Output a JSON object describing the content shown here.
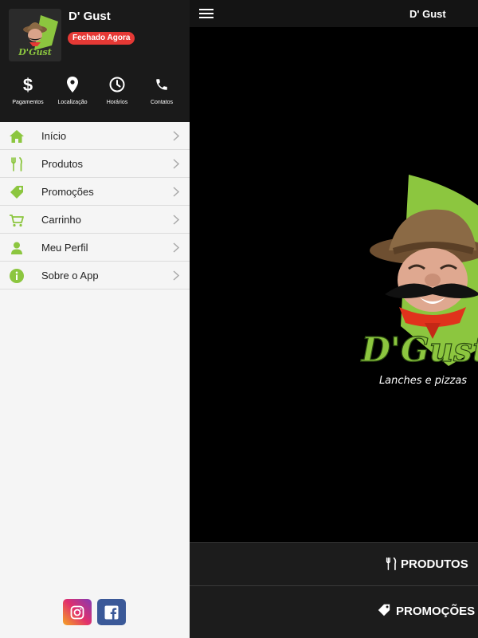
{
  "drawer": {
    "store_name": "D' Gust",
    "status": "Fechado Agora",
    "logo_text": "D'Gust",
    "quick_actions": [
      {
        "label": "Pagamentos",
        "icon": "dollar-icon"
      },
      {
        "label": "Localização",
        "icon": "location-pin-icon"
      },
      {
        "label": "Horários",
        "icon": "clock-icon"
      },
      {
        "label": "Contatos",
        "icon": "phone-icon"
      }
    ],
    "menu": [
      {
        "label": "Início",
        "icon": "home-icon"
      },
      {
        "label": "Produtos",
        "icon": "cutlery-icon"
      },
      {
        "label": "Promoções",
        "icon": "tag-icon"
      },
      {
        "label": "Carrinho",
        "icon": "cart-icon"
      },
      {
        "label": "Meu Perfil",
        "icon": "user-icon"
      },
      {
        "label": "Sobre o App",
        "icon": "info-icon"
      }
    ],
    "social": [
      {
        "name": "instagram",
        "icon": "instagram-icon"
      },
      {
        "name": "facebook",
        "icon": "facebook-icon"
      }
    ]
  },
  "topbar": {
    "title": "D' Gust",
    "menu_icon": "hamburger-icon"
  },
  "hero": {
    "brand": "D'Gust",
    "tagline": "Lanches e pizzas"
  },
  "buttons": {
    "produtos": "PRODUTOS",
    "promocoes": "PROMOÇÕES"
  },
  "colors": {
    "accent_green": "#8cc63f",
    "status_red": "#e53935",
    "drawer_header_bg": "#1a1a1a",
    "drawer_bg": "#f5f5f5",
    "topbar_bg": "#141414",
    "button_bg": "#1c1c1c",
    "instagram": "#e1306c",
    "facebook": "#3b5998"
  }
}
